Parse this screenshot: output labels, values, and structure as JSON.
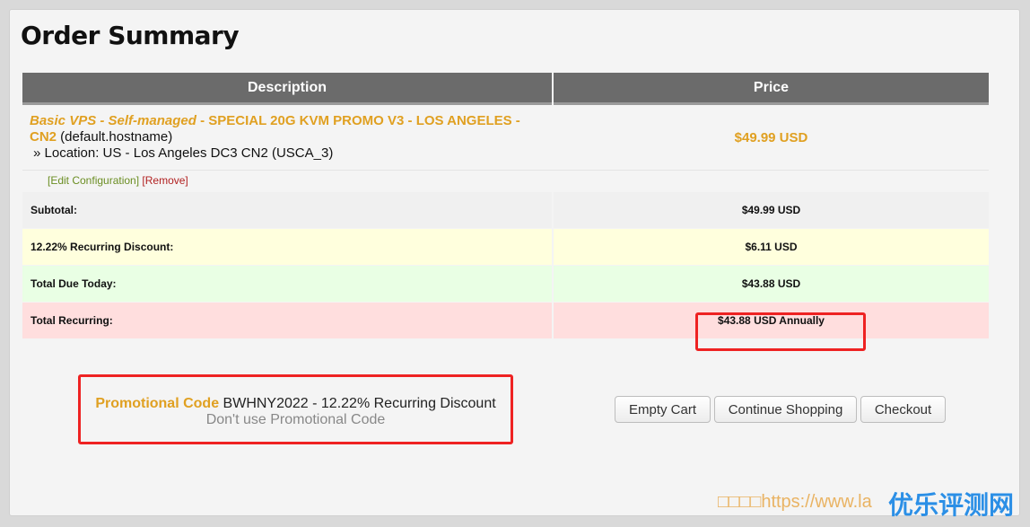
{
  "page": {
    "title": "Order Summary"
  },
  "table": {
    "header": {
      "description": "Description",
      "price": "Price"
    },
    "item": {
      "product_group": "Basic VPS - Self-managed",
      "separator": " - ",
      "product_name": "SPECIAL 20G KVM PROMO V3 - LOS ANGELES - CN2",
      "hostname": " (default.hostname)",
      "location": "» Location: US - Los Angeles DC3 CN2 (USCA_3)",
      "price": "$49.99 USD",
      "edit_label": "[Edit Configuration]",
      "remove_label": "[Remove]"
    },
    "summary": {
      "subtotal_label": "Subtotal:",
      "subtotal_value": "$49.99 USD",
      "discount_label": "12.22% Recurring Discount:",
      "discount_value": "$6.11 USD",
      "due_label": "Total Due Today:",
      "due_value": "$43.88 USD",
      "recurring_label": "Total Recurring:",
      "recurring_value": "$43.88 USD Annually"
    }
  },
  "promo": {
    "label": "Promotional Code",
    "code_text": " BWHNY2022 - 12.22% Recurring Discount",
    "remove_label": "Don't use Promotional Code"
  },
  "buttons": {
    "empty_cart": "Empty Cart",
    "continue_shopping": "Continue Shopping",
    "checkout": "Checkout"
  },
  "watermark": {
    "url": "□□□□https://www.la",
    "brand": "优乐评测网"
  },
  "colors": {
    "accent": "#e0a021",
    "header_bg": "#6b6b6b",
    "highlight_border": "#ee2222",
    "edit_link": "#6b8e23",
    "remove_link": "#b22222"
  }
}
